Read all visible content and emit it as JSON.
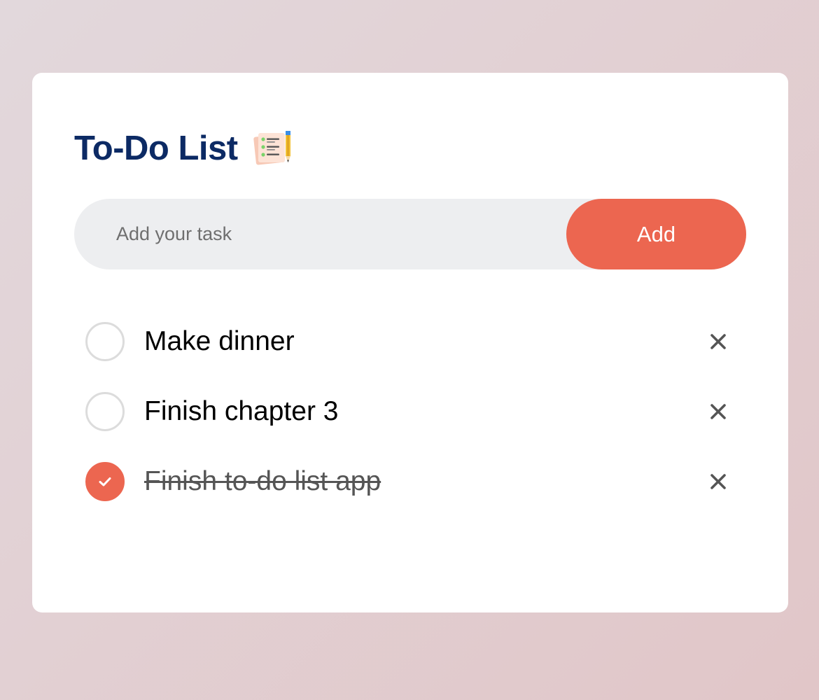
{
  "app": {
    "title": "To-Do List",
    "title_icon": "checklist-notepad-pencil-icon"
  },
  "input": {
    "placeholder": "Add your task",
    "value": ""
  },
  "add_button": {
    "label": "Add"
  },
  "tasks": [
    {
      "text": "Make dinner",
      "completed": false
    },
    {
      "text": "Finish chapter 3",
      "completed": false
    },
    {
      "text": "Finish to-do list app",
      "completed": true
    }
  ],
  "colors": {
    "accent": "#ec6650",
    "title": "#0c2a64",
    "input_bg": "#edeef0",
    "checkbox_border": "#dcdcdc",
    "delete_icon": "#555555"
  },
  "icons": {
    "delete": "close-icon",
    "checked": "checkmark-icon",
    "unchecked": "circle-icon"
  }
}
